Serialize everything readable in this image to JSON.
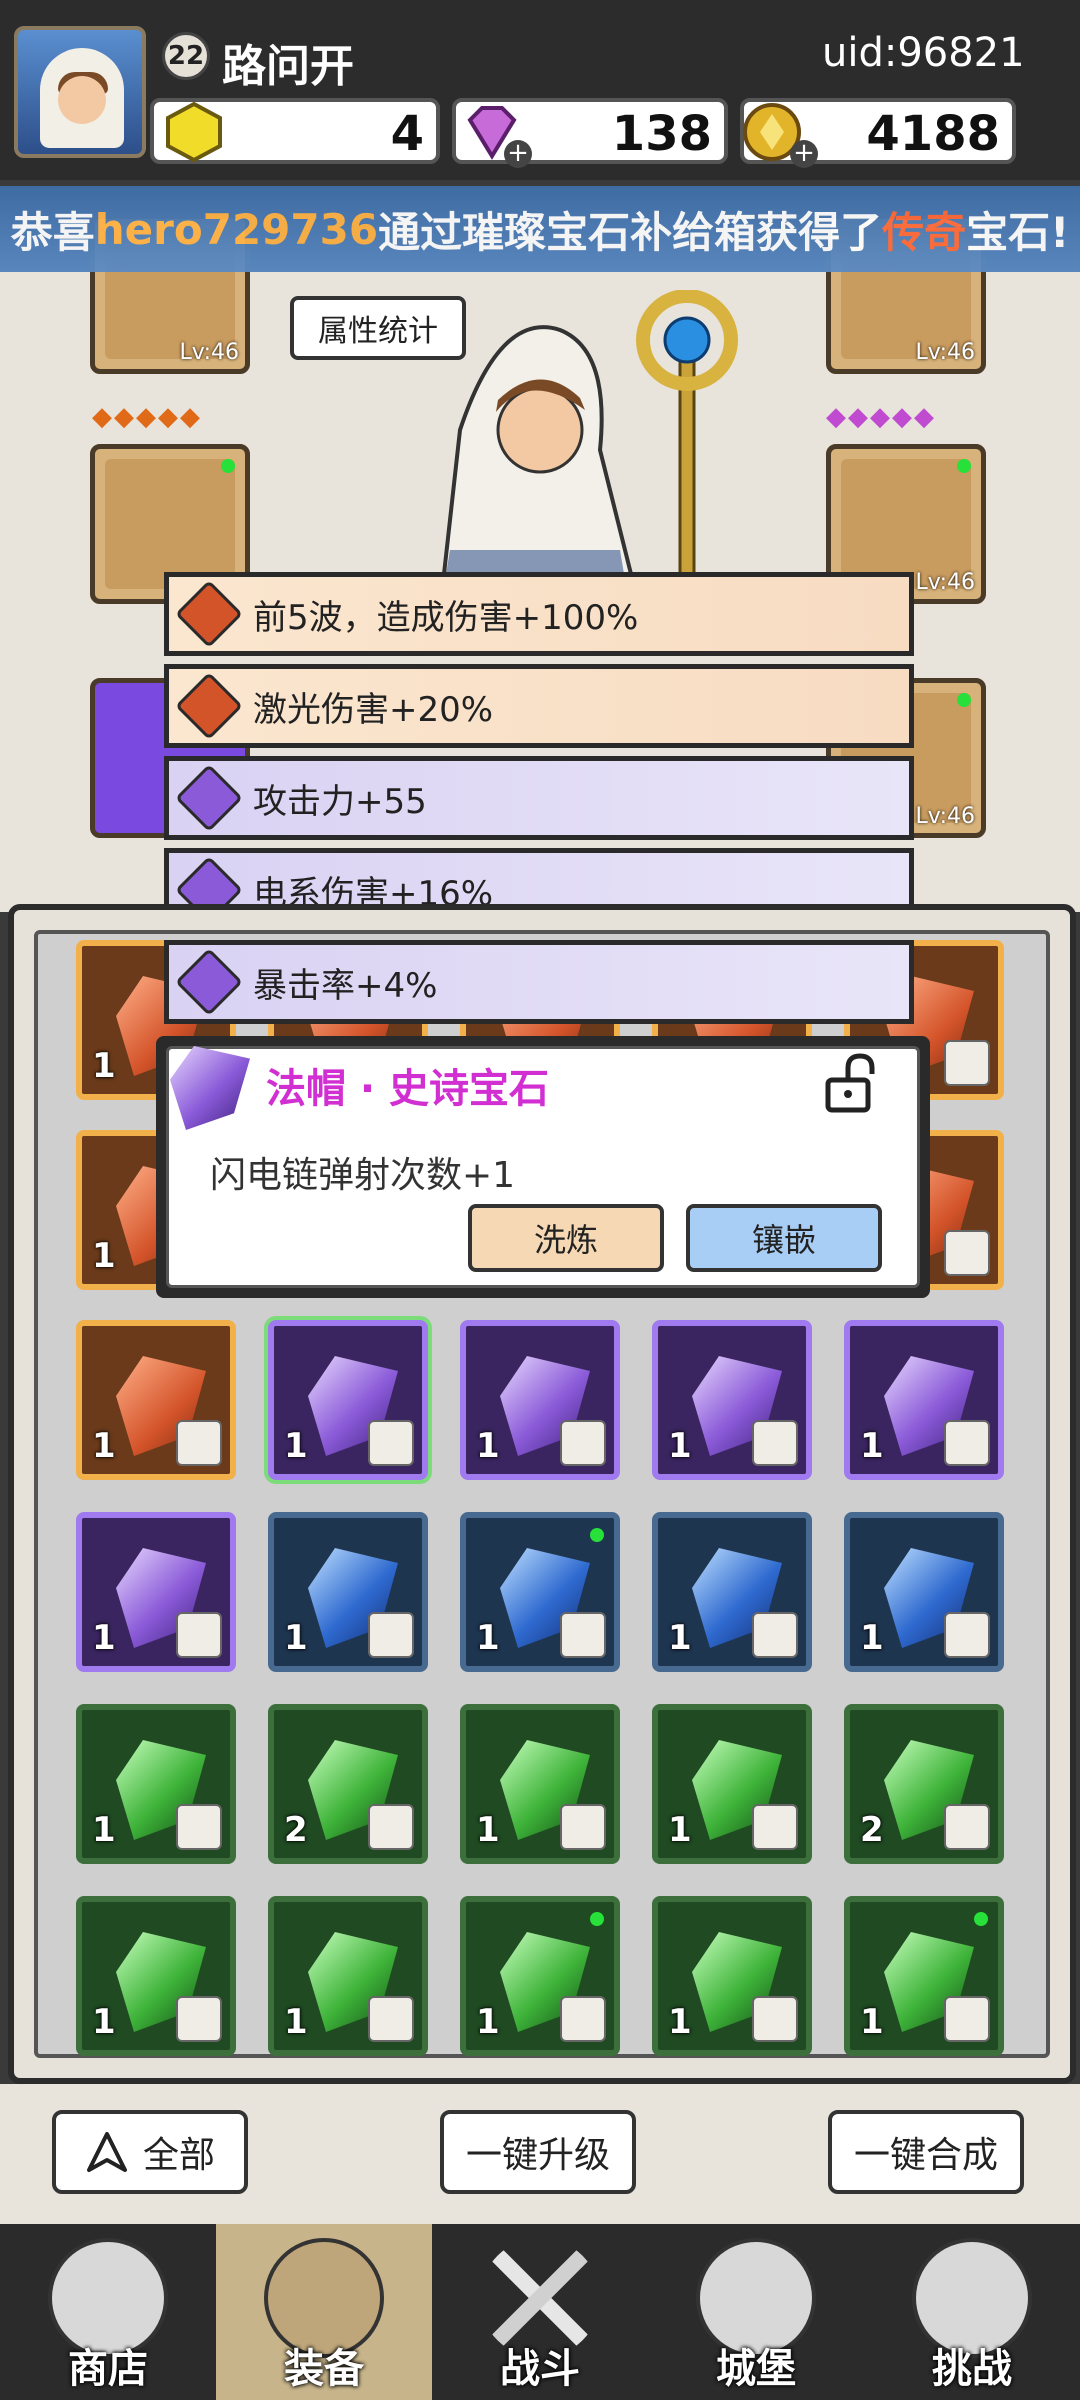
{
  "header": {
    "level": "22",
    "player_name": "路问开",
    "uid": "uid:96821",
    "resources": [
      {
        "name": "gold-gem",
        "value": "4",
        "color": "#f2dc2a"
      },
      {
        "name": "diamond",
        "value": "138",
        "color": "#c66bd8"
      },
      {
        "name": "coin",
        "value": "4188",
        "color": "#e1b42a"
      }
    ]
  },
  "broadcast": {
    "prefix": "恭喜",
    "user": "hero729736",
    "middle": "通过璀璨宝石补给箱获得了",
    "quality": "传奇",
    "suffix": "宝石!"
  },
  "equipment": {
    "attr_button": "属性统计",
    "slots": [
      {
        "level": "Lv:46"
      },
      {
        "level": "Lv:46"
      },
      {
        "level": "Lv:46"
      },
      {
        "level": "Lv:46"
      }
    ],
    "diamond_row_left": "◆◆◆◆◆",
    "diamond_row_right": "◆◆◆◆◆"
  },
  "stats": [
    {
      "text": "前5波，造成伤害+100%",
      "rarity": "legendary"
    },
    {
      "text": "激光伤害+20%",
      "rarity": "legendary"
    },
    {
      "text": "攻击力+55",
      "rarity": "epic"
    },
    {
      "text": "电系伤害+16%",
      "rarity": "epic"
    },
    {
      "text": "暴击率+4%",
      "rarity": "epic"
    }
  ],
  "popup": {
    "title": "法帽 · 史诗宝石",
    "description": "闪电链弹射次数+1",
    "refine_button": "洗炼",
    "inlay_button": "镶嵌"
  },
  "inventory": {
    "rows": [
      [
        {
          "c": "orange",
          "n": "1"
        },
        {
          "c": "orange",
          "n": ""
        },
        {
          "c": "orange",
          "n": ""
        },
        {
          "c": "orange",
          "n": ""
        },
        {
          "c": "orange",
          "n": ""
        }
      ],
      [
        {
          "c": "orange",
          "n": "1"
        },
        {
          "c": "orange",
          "n": ""
        },
        {
          "c": "orange",
          "n": ""
        },
        {
          "c": "orange",
          "n": ""
        },
        {
          "c": "orange",
          "n": ""
        }
      ],
      [
        {
          "c": "orange",
          "n": "1"
        },
        {
          "c": "purple",
          "n": "1"
        },
        {
          "c": "purple",
          "n": "1"
        },
        {
          "c": "purple",
          "n": "1"
        },
        {
          "c": "purple",
          "n": "1"
        }
      ],
      [
        {
          "c": "purple",
          "n": "1"
        },
        {
          "c": "blue",
          "n": "1"
        },
        {
          "c": "blue",
          "n": "1"
        },
        {
          "c": "blue",
          "n": "1"
        },
        {
          "c": "blue",
          "n": "1"
        }
      ],
      [
        {
          "c": "green",
          "n": "1"
        },
        {
          "c": "green",
          "n": "2"
        },
        {
          "c": "green",
          "n": "1"
        },
        {
          "c": "green",
          "n": "1"
        },
        {
          "c": "green",
          "n": "2"
        }
      ],
      [
        {
          "c": "green",
          "n": "1"
        },
        {
          "c": "green",
          "n": "1"
        },
        {
          "c": "green",
          "n": "1"
        },
        {
          "c": "green",
          "n": "1"
        },
        {
          "c": "green",
          "n": "1"
        }
      ]
    ]
  },
  "actions": {
    "filter_all": "全部",
    "upgrade_all": "一键升级",
    "merge_all": "一键合成"
  },
  "nav": [
    {
      "label": "商店",
      "active": false
    },
    {
      "label": "装备",
      "active": true
    },
    {
      "label": "战斗",
      "active": false
    },
    {
      "label": "城堡",
      "active": false
    },
    {
      "label": "挑战",
      "active": false
    }
  ]
}
